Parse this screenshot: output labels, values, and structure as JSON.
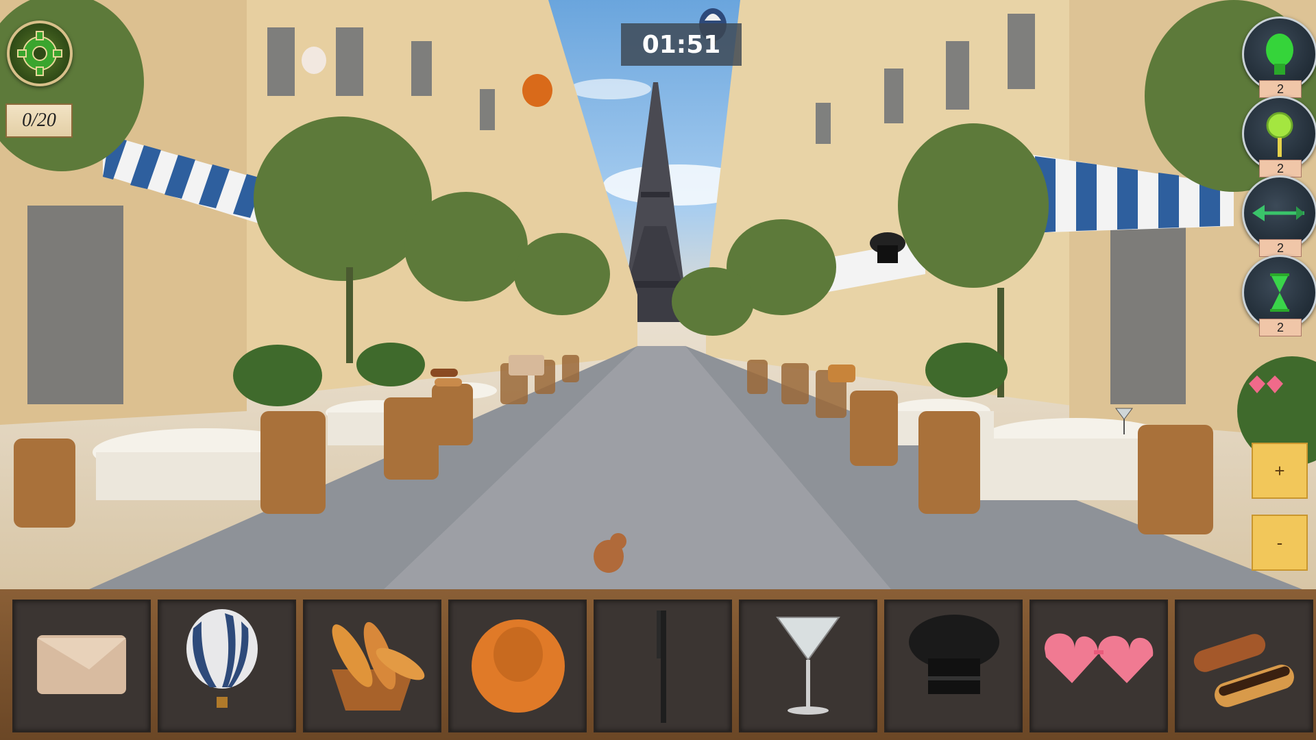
{
  "hud": {
    "found_counter": "0/20",
    "timer": "01:51"
  },
  "hints": [
    {
      "icon": "lightbulb-icon",
      "count": "2"
    },
    {
      "icon": "magnifier-icon",
      "count": "2"
    },
    {
      "icon": "arrow-icon",
      "count": "2"
    },
    {
      "icon": "hourglass-icon",
      "count": "2"
    }
  ],
  "zoom": {
    "in_label": "+",
    "out_label": "-"
  },
  "items_to_find": [
    {
      "name": "clutch-purse",
      "icon": "clutch-purse-icon"
    },
    {
      "name": "hot-air-balloon",
      "icon": "hot-air-balloon-icon"
    },
    {
      "name": "bread-basket",
      "icon": "bread-basket-icon"
    },
    {
      "name": "orange-hat",
      "icon": "orange-hat-icon"
    },
    {
      "name": "comb",
      "icon": "comb-icon"
    },
    {
      "name": "martini-glass",
      "icon": "martini-glass-icon"
    },
    {
      "name": "chef-hat",
      "icon": "chef-hat-icon"
    },
    {
      "name": "heart-sunglasses",
      "icon": "heart-sunglasses-icon"
    },
    {
      "name": "eclairs",
      "icon": "eclairs-icon"
    }
  ],
  "colors": {
    "item_bar": "#7a5430",
    "slot_bg": "#3b3532",
    "timer_bg": "#3c4650",
    "zoom_button": "#f2c75a",
    "awning_blue": "#2e5f9e"
  }
}
